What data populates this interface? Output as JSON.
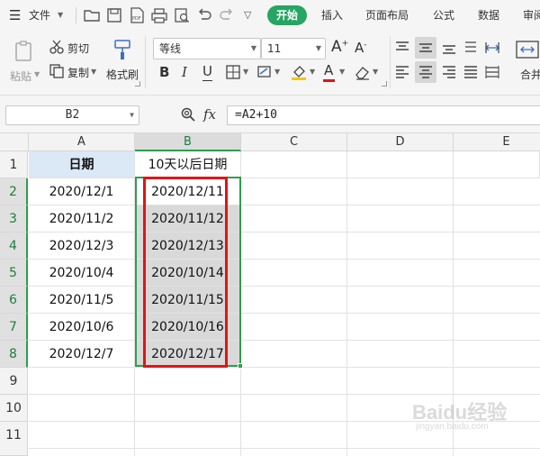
{
  "menubar": {
    "file_label": "文件",
    "tabs": [
      "开始",
      "插入",
      "页面布局",
      "公式",
      "数据",
      "审阅"
    ]
  },
  "ribbon": {
    "paste_label": "粘贴",
    "cut_label": "剪切",
    "copy_label": "复制",
    "format_painter_label": "格式刷",
    "font_name": "等线",
    "font_size": "11",
    "merge_label": "合并"
  },
  "formula_bar": {
    "name_box": "B2",
    "fx_label": "fx",
    "formula": "=A2+10"
  },
  "sheet": {
    "columns": [
      "A",
      "B",
      "C",
      "D",
      "E"
    ],
    "rows": [
      "1",
      "2",
      "3",
      "4",
      "5",
      "6",
      "7",
      "8",
      "9",
      "10",
      "11"
    ],
    "header_a": "日期",
    "header_b": "10天以后日期",
    "col_a": [
      "2020/12/1",
      "2020/11/2",
      "2020/12/3",
      "2020/10/4",
      "2020/11/5",
      "2020/10/6",
      "2020/12/7"
    ],
    "col_b": [
      "2020/12/11",
      "2020/11/12",
      "2020/12/13",
      "2020/10/14",
      "2020/11/15",
      "2020/10/16",
      "2020/12/17"
    ]
  },
  "colors": {
    "accent_green": "#27a563",
    "selection_green": "#2e9e4e",
    "highlight_red": "#e01515",
    "header_blue": "#dbe8f6"
  },
  "watermark": {
    "brand": "Baidu经验",
    "url": "jingyan.baidu.com"
  }
}
